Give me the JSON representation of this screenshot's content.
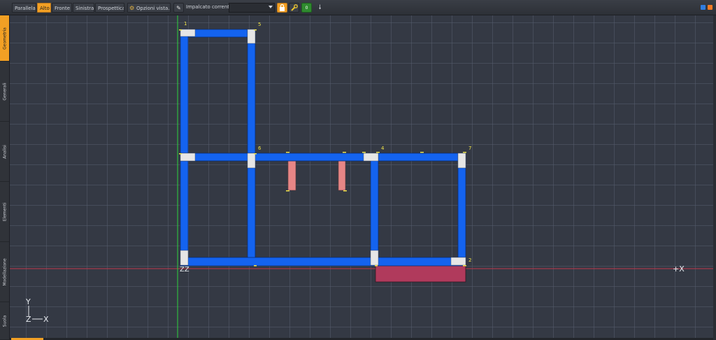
{
  "toolbar": {
    "views": [
      "Parallela",
      "Alto",
      "Fronte",
      "Sinistra",
      "Prospettica"
    ],
    "active_view": "Alto",
    "view_options_label": "Opzioni vista...",
    "current_floor_label": "Impalcato corrente:",
    "current_floor_value": "",
    "lock_icon": "lock-icon",
    "wrench_icon": "wrench-icon",
    "badge_value": "0"
  },
  "side_tabs": [
    "Geometria",
    "Generali",
    "Analisi",
    "Elementi",
    "Modellazione",
    "Suola"
  ],
  "active_tab": "Geometria",
  "canvas": {
    "node_labels": [
      "1",
      "5",
      "6",
      "4",
      "7",
      "2"
    ],
    "x_axis_label": "+X",
    "origin_label": "ZZ",
    "gizmo": {
      "y": "Y",
      "z": "Z",
      "x": "X"
    }
  },
  "colors": {
    "accent": "#f2a024",
    "beam": "#1463ef",
    "pink_element": "#e78686",
    "foundation": "#b03a5c",
    "node": "#e6e6e6",
    "x_axis": "#c0384a",
    "y_axis": "#2dd23c",
    "label": "#f0e44a"
  }
}
